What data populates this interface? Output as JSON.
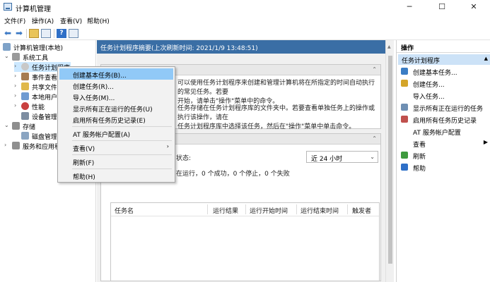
{
  "window": {
    "title": "计算机管理",
    "minimize": "─",
    "maximize": "☐",
    "close": "✕"
  },
  "menubar": [
    "文件(F)",
    "操作(A)",
    "查看(V)",
    "帮助(H)"
  ],
  "tree": {
    "root": "计算机管理(本地)",
    "system_tools": "系统工具",
    "task_scheduler": "任务计划程序",
    "event_viewer": "事件查看器",
    "shared_folders": "共享文件夹",
    "local_users": "本地用户和组",
    "performance": "性能",
    "device_manager": "设备管理器",
    "storage": "存储",
    "disk_mgmt": "磁盘管理",
    "services": "服务和应用程序"
  },
  "center": {
    "header": "任务计划程序摘要(上次刷新时间: 2021/1/9 13:48:51)",
    "desc1_line1": "可以使用任务计划程序来创建和管理计算机将在所指定的时间自动执行的常见任务。若要",
    "desc1_line2": "开始，请单击\"操作\"菜单中的命令。",
    "desc2_line1": "任务存储在任务计划程序库的文件夹中。若要查看单独任务上的操作或执行该操作，请在",
    "desc2_line2": "任务计划程序库中选择该任务，然后在\"操作\"菜单中单击命令。",
    "status_label": "状态:",
    "status_summary": "在运行，0 个成功，0 个停止，0 个失败",
    "range_value": "近 24 小时",
    "table_headers": [
      "任务名",
      "运行结果",
      "运行开始时间",
      "运行结束时间",
      "触发者"
    ]
  },
  "actions": {
    "title": "操作",
    "section": "任务计划程序",
    "items": [
      {
        "label": "创建基本任务...",
        "icon": "wizard-icon",
        "color": "#3b7dc4"
      },
      {
        "label": "创建任务...",
        "icon": "task-icon",
        "color": "#d4a52a"
      },
      {
        "label": "导入任务...",
        "icon": "",
        "color": ""
      },
      {
        "label": "显示所有正在运行的任务",
        "icon": "list-icon",
        "color": "#6f8fb3"
      },
      {
        "label": "启用所有任务历史记录",
        "icon": "history-icon",
        "color": "#c0504d"
      },
      {
        "label": "AT 服务帐户配置",
        "icon": "",
        "color": ""
      },
      {
        "label": "查看",
        "icon": "",
        "color": "",
        "submenu": "▶"
      },
      {
        "label": "刷新",
        "icon": "refresh-icon",
        "color": "#3e9a3e"
      },
      {
        "label": "帮助",
        "icon": "help-icon",
        "color": "#2e6fc7"
      }
    ]
  },
  "context_menu": {
    "items": [
      "创建基本任务(B)...",
      "创建任务(R)...",
      "导入任务(M)...",
      "显示所有正在运行的任务(U)",
      "启用所有任务历史记录(E)",
      "AT 服务帐户配置(A)",
      "查看(V)",
      "刷新(F)",
      "帮助(H)"
    ],
    "submenu_arrow": "›"
  }
}
